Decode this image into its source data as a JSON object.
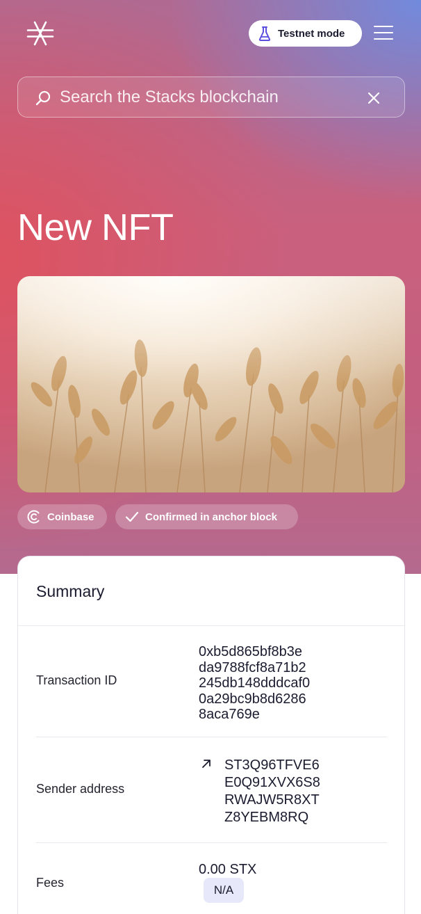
{
  "header": {
    "network_badge_label": "Testnet mode"
  },
  "search": {
    "placeholder": "Search the Stacks blockchain"
  },
  "page": {
    "title": "New NFT"
  },
  "badges": {
    "type_label": "Coinbase",
    "status_label": "Confirmed in anchor block"
  },
  "summary": {
    "title": "Summary",
    "transaction_id_label": "Transaction ID",
    "transaction_id_lines": [
      "0xb5d865bf8b3e",
      "da9788fcf8a71b2",
      "245db148dddcaf0",
      "0a29bc9b8d6286",
      "8aca769e"
    ],
    "sender_address_label": "Sender address",
    "sender_address_lines": [
      "ST3Q96TFVE6",
      "E0Q91XVX6S8",
      "RWAJW5R8XT",
      "Z8YEBM8RQ"
    ],
    "fees_label": "Fees",
    "fees_value": "0.00 STX",
    "fees_badge": "N/A"
  },
  "icons": {
    "logo": "stacks-logo-icon",
    "testnet": "flask-icon",
    "menu": "hamburger-menu-icon",
    "search": "search-icon",
    "clear": "close-icon",
    "coinbase": "coinbase-icon",
    "confirmed": "checkmark-icon",
    "sender": "arrow-up-right-icon"
  },
  "colors": {
    "hero_red": "#de525f",
    "hero_blue": "#6e8ce1",
    "flask_purple": "#5b4de0",
    "text_dark": "#1b1b2f",
    "na_badge_bg": "#e8e8fb"
  }
}
